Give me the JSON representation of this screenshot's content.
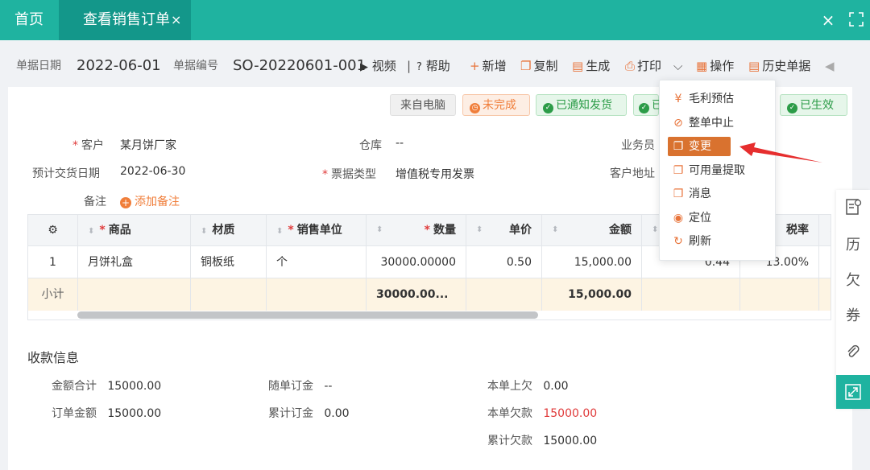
{
  "tabs": {
    "home": "首页",
    "active": "查看销售订单",
    "active_close": "×",
    "window_close": "×"
  },
  "toolbar": {
    "date_label": "单据日期",
    "date_value": "2022-06-01",
    "no_label": "单据编号",
    "no_value": "SO-20220601-001",
    "video": "视频",
    "sep": "|",
    "help": "帮助",
    "add": "新增",
    "copy": "复制",
    "generate": "生成",
    "print": "打印",
    "operate": "操作",
    "history": "历史单据"
  },
  "badges": {
    "source": "来自电脑",
    "incomplete": "未完成",
    "notified": "已通知发货",
    "partial": "已",
    "effective": "已生效"
  },
  "form": {
    "customer_label": "客户",
    "customer_value": "某月饼厂家",
    "warehouse_label": "仓库",
    "warehouse_value": "--",
    "salesman_label": "业务员",
    "delivery_label": "预计交货日期",
    "delivery_value": "2022-06-30",
    "invoice_label": "票据类型",
    "invoice_value": "增值税专用发票",
    "address_label": "客户地址",
    "remark_label": "备注",
    "remark_add": "添加备注"
  },
  "table": {
    "headers": {
      "product": "商品",
      "material": "材质",
      "unit": "销售单位",
      "qty": "数量",
      "price": "单价",
      "amount": "金额",
      "tax_amount": "",
      "tax_rate": "税率"
    },
    "rows": [
      {
        "idx": "1",
        "product": "月饼礼盒",
        "material": "铜板纸",
        "unit": "个",
        "qty": "30000.00000",
        "price": "0.50",
        "amount": "15,000.00",
        "tax_amount": "0.44",
        "tax_rate": "13.00%"
      }
    ],
    "subtotal": {
      "label": "小计",
      "qty": "30000.00...",
      "amount": "15,000.00"
    }
  },
  "payment": {
    "title": "收款信息",
    "total_label": "金额合计",
    "total_value": "15000.00",
    "order_amount_label": "订单金额",
    "order_amount_value": "15000.00",
    "deposit_label": "随单订金",
    "deposit_value": "--",
    "cum_deposit_label": "累计订金",
    "cum_deposit_value": "0.00",
    "prev_owe_label": "本单上欠",
    "prev_owe_value": "0.00",
    "owe_label": "本单欠款",
    "owe_value": "15000.00",
    "cum_owe_label": "累计欠款",
    "cum_owe_value": "15000.00"
  },
  "menu": {
    "items": [
      {
        "label": "毛利预估",
        "icon": "¥"
      },
      {
        "label": "整单中止",
        "icon": "⊘"
      },
      {
        "label": "变更",
        "icon": "❐"
      },
      {
        "label": "可用量提取",
        "icon": "❐"
      },
      {
        "label": "消息",
        "icon": "❐"
      },
      {
        "label": "定位",
        "icon": "◉"
      },
      {
        "label": "刷新",
        "icon": "↻"
      }
    ]
  },
  "rightbar": {
    "history": "历",
    "owe": "欠",
    "coupon": "券"
  },
  "colors": {
    "teal": "#1fb3a0",
    "teal_dark": "#13978a",
    "orange": "#e8743b",
    "red_arrow": "#e62e2e"
  }
}
